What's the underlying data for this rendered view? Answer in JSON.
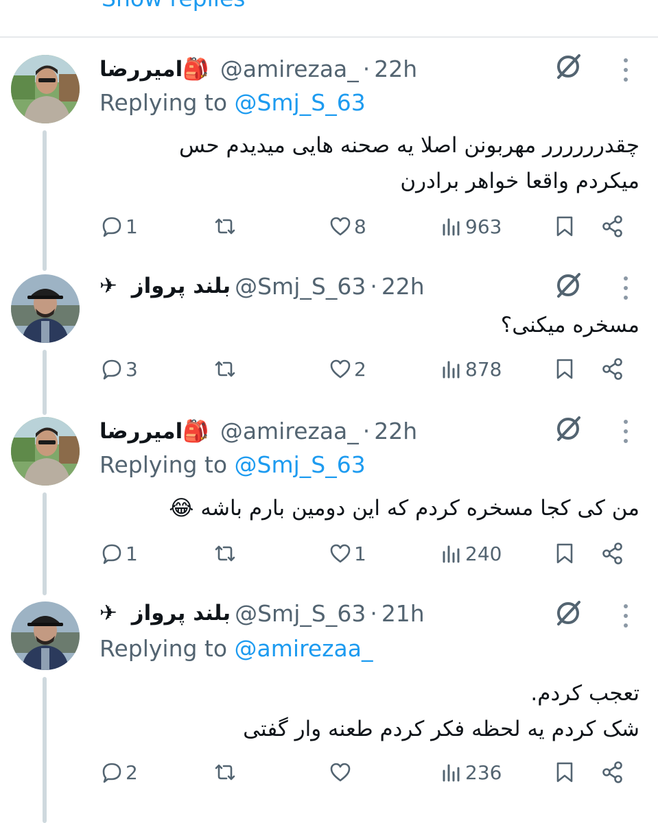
{
  "top": {
    "show_replies_label": "Show replies"
  },
  "tweets": [
    {
      "display_name": "امیررضا",
      "name_emoji": "🎒",
      "handle": "@amirezaa_",
      "separator": "·",
      "time": "22h",
      "replying_prefix": "Replying to",
      "replying_to": "@Smj_S_63",
      "body": "چقدرررررر مهربونن اصلا یه صحنه هایی میدیدم حس\nمیکردم واقعا خواهر برادرن",
      "replies": "1",
      "retweets": "",
      "likes": "8",
      "views": "963"
    },
    {
      "display_name": "بلند پرواز",
      "name_emoji": "✈",
      "handle": "@Smj_S_63",
      "separator": "·",
      "time": "22h",
      "replying_prefix": "",
      "replying_to": "",
      "body": "مسخره میکنی؟",
      "replies": "3",
      "retweets": "",
      "likes": "2",
      "views": "878"
    },
    {
      "display_name": "امیررضا",
      "name_emoji": "🎒",
      "handle": "@amirezaa_",
      "separator": "·",
      "time": "22h",
      "replying_prefix": "Replying to",
      "replying_to": "@Smj_S_63",
      "body": "من کی کجا مسخره کردم که این دومین بارم باشه 😂",
      "replies": "1",
      "retweets": "",
      "likes": "1",
      "views": "240"
    },
    {
      "display_name": "بلند پرواز",
      "name_emoji": "✈",
      "handle": "@Smj_S_63",
      "separator": "·",
      "time": "21h",
      "replying_prefix": "Replying to",
      "replying_to": "@amirezaa_",
      "body": "تعجب کردم.\nشک کردم یه لحظه فکر کردم طعنه وار گفتی",
      "replies": "2",
      "retweets": "",
      "likes": "",
      "views": "236"
    }
  ],
  "colors": {
    "accent": "#1d9bf0",
    "text_primary": "#0f1419",
    "text_secondary": "#536471",
    "thread_line": "#cfd9de",
    "divider": "#e6e9eb"
  },
  "icons": {
    "reply": "speech-bubble-icon",
    "retweet": "retweet-icon",
    "like": "heart-icon",
    "views": "bar-chart-icon",
    "bookmark": "bookmark-icon",
    "share": "share-icon",
    "grok": "grok-icon",
    "more": "more-vertical-icon"
  }
}
